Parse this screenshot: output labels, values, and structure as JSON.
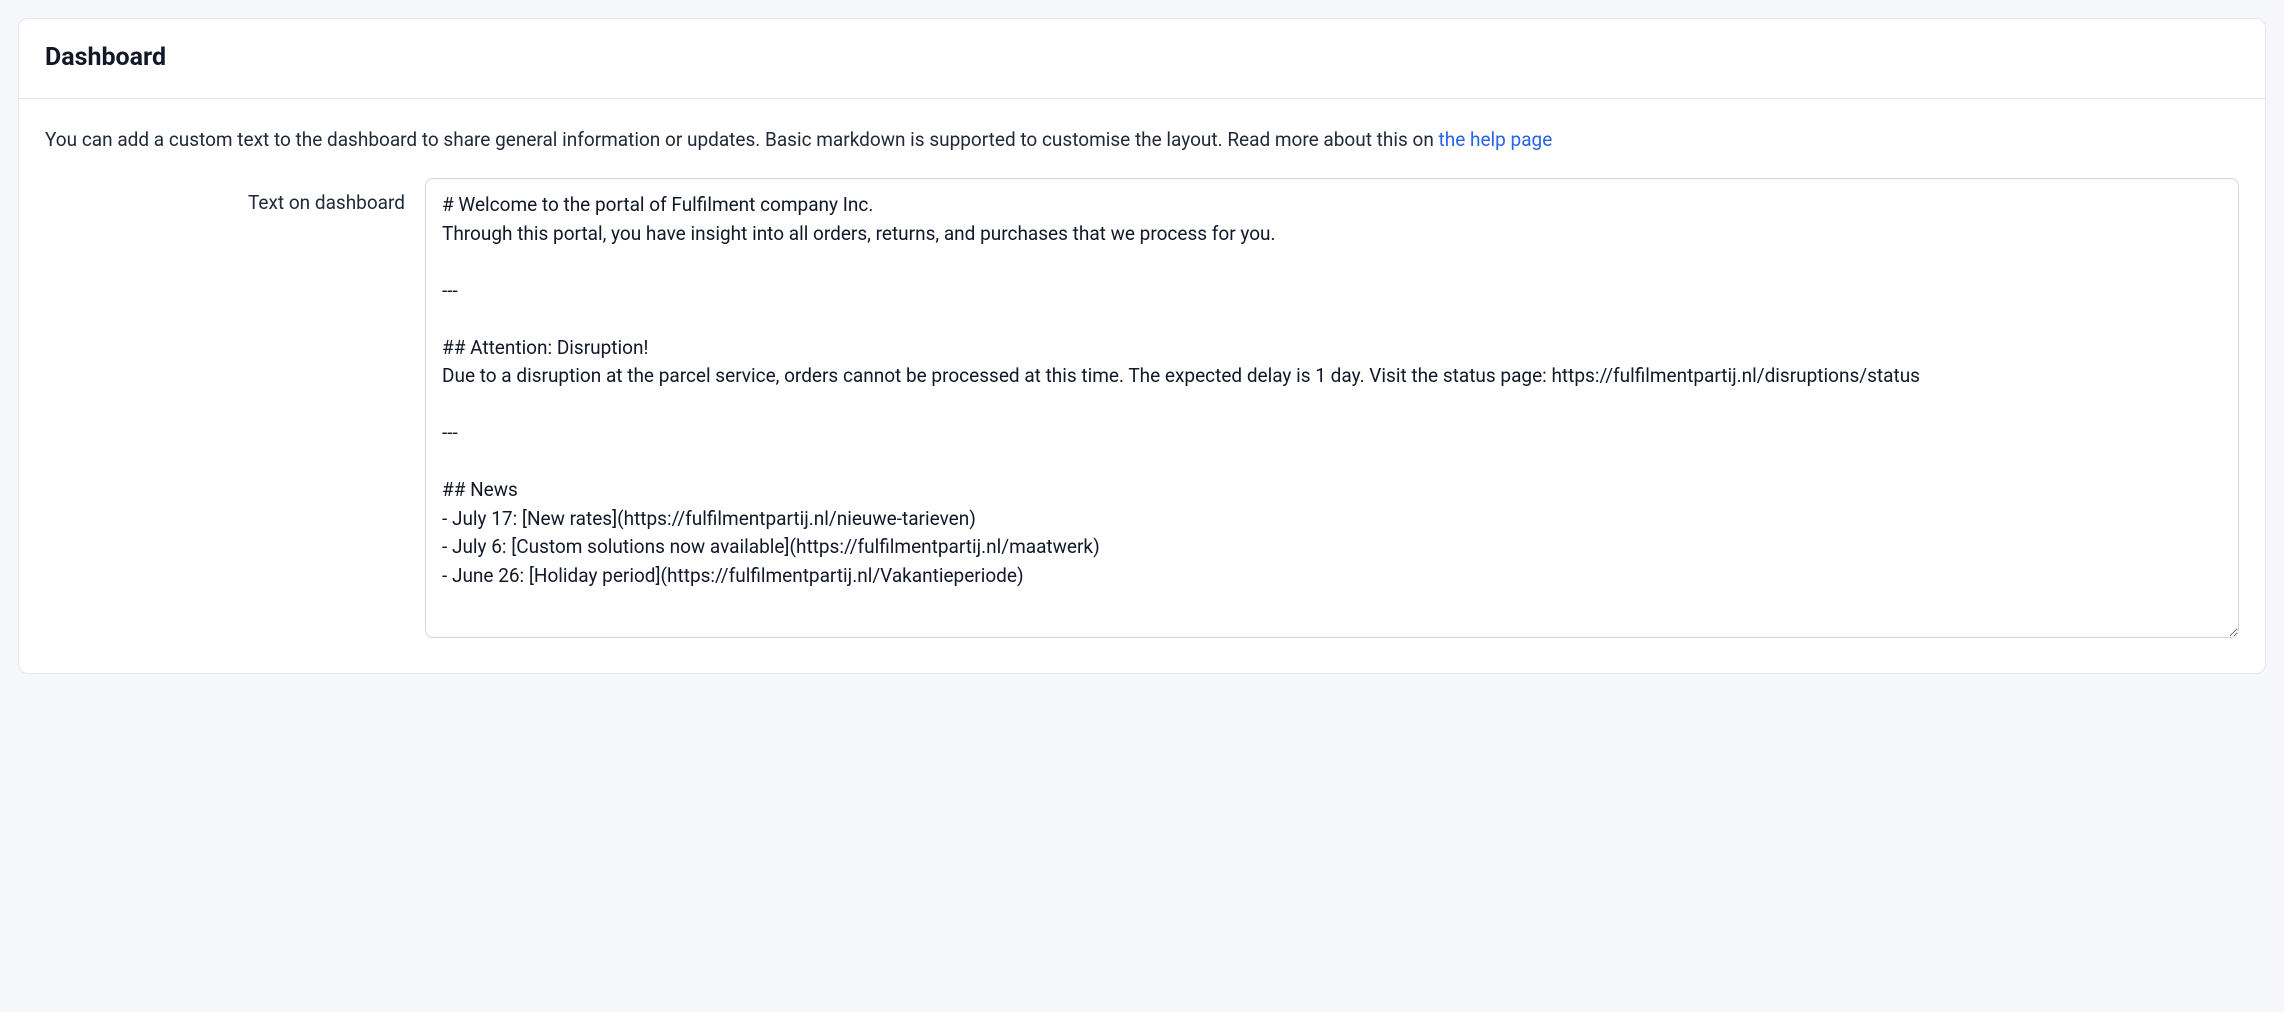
{
  "header": {
    "title": "Dashboard"
  },
  "description": {
    "prefix": "You can add a custom text to the dashboard to share general information or updates. Basic markdown is supported to customise the layout. Read more about this on ",
    "link_text": "the help page"
  },
  "form": {
    "label": "Text on dashboard",
    "value": "# Welcome to the portal of Fulfilment company Inc.\nThrough this portal, you have insight into all orders, returns, and purchases that we process for you.\n\n---\n\n## Attention: Disruption!\nDue to a disruption at the parcel service, orders cannot be processed at this time. The expected delay is 1 day. Visit the status page: https://fulfilmentpartij.nl/disruptions/status\n\n---\n\n## News\n- July 17: [New rates](https://fulfilmentpartij.nl/nieuwe-tarieven)\n- July 6: [Custom solutions now available](https://fulfilmentpartij.nl/maatwerk)\n- June 26: [Holiday period](https://fulfilmentpartij.nl/Vakantieperiode)"
  }
}
